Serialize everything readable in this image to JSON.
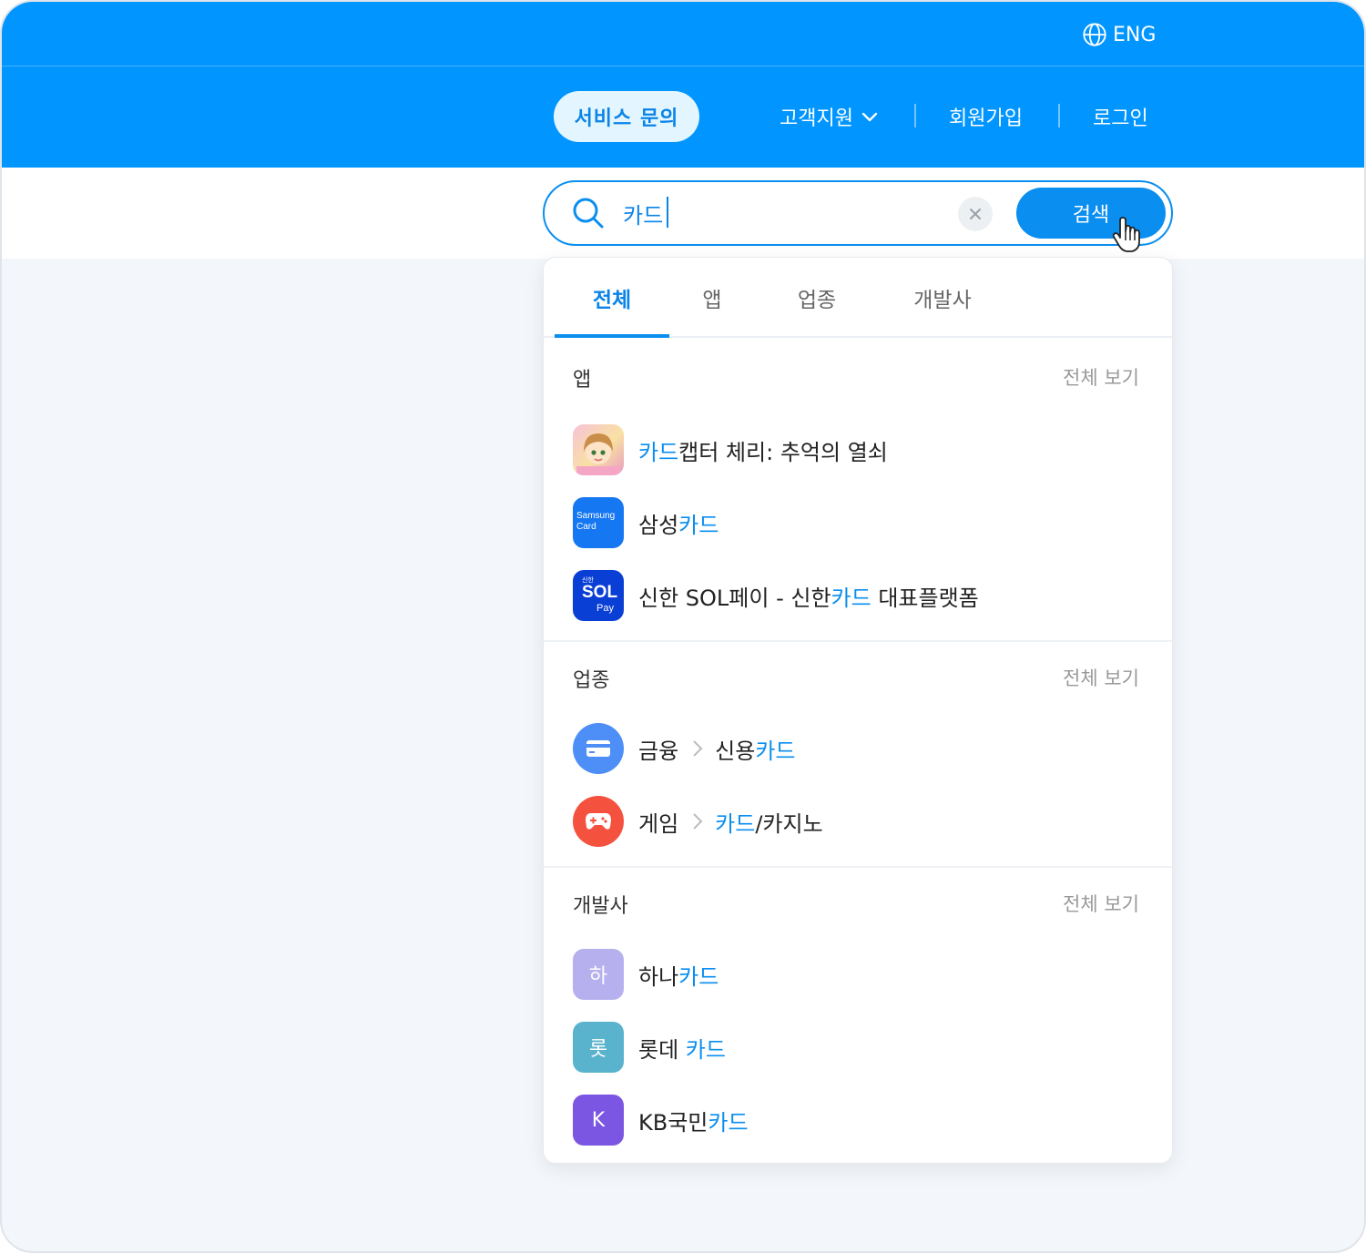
{
  "header": {
    "language_label": "ENG",
    "service_inquiry": "서비스 문의",
    "nav": [
      {
        "label": "고객지원"
      },
      {
        "label": "회원가입"
      },
      {
        "label": "로그인"
      }
    ]
  },
  "search": {
    "query": "카드",
    "button_label": "검색"
  },
  "tabs": [
    {
      "label": "전체",
      "active": true
    },
    {
      "label": "앱",
      "active": false
    },
    {
      "label": "업종",
      "active": false
    },
    {
      "label": "개발사",
      "active": false
    }
  ],
  "sections": {
    "apps": {
      "title": "앱",
      "see_all": "전체 보기",
      "items": [
        {
          "pre": "",
          "hl": "카드",
          "post": "캡터 체리: 추억의 열쇠"
        },
        {
          "pre": "삼성",
          "hl": "카드",
          "post": "",
          "icon_text_1": "Samsung",
          "icon_text_2": "Card"
        },
        {
          "pre": "신한 SOL페이 - 신한",
          "hl": "카드",
          "post": " 대표플랫폼",
          "icon_text_1": "신한",
          "icon_text_2": "SOL",
          "icon_text_3": "Pay"
        }
      ]
    },
    "categories": {
      "title": "업종",
      "see_all": "전체 보기",
      "items": [
        {
          "parent": "금융",
          "pre": "신용",
          "hl": "카드",
          "post": "",
          "icon": "credit-card-icon",
          "color": "#4d8ef7"
        },
        {
          "parent": "게임",
          "pre": "",
          "hl": "카드",
          "post": "/카지노",
          "icon": "gamepad-icon",
          "color": "#f5513f"
        }
      ]
    },
    "developers": {
      "title": "개발사",
      "see_all": "전체 보기",
      "items": [
        {
          "letter": "하",
          "pre": "하나",
          "hl": "카드",
          "post": "",
          "color": "#b7b0ef"
        },
        {
          "letter": "롯",
          "pre": "롯데 ",
          "hl": "카드",
          "post": "",
          "color": "#5ab3cc"
        },
        {
          "letter": "K",
          "pre": "KB국민",
          "hl": "카드",
          "post": "",
          "color": "#7a56e3"
        }
      ]
    }
  },
  "colors": {
    "brand_blue": "#0095ff",
    "highlight": "#0a8ef0"
  }
}
